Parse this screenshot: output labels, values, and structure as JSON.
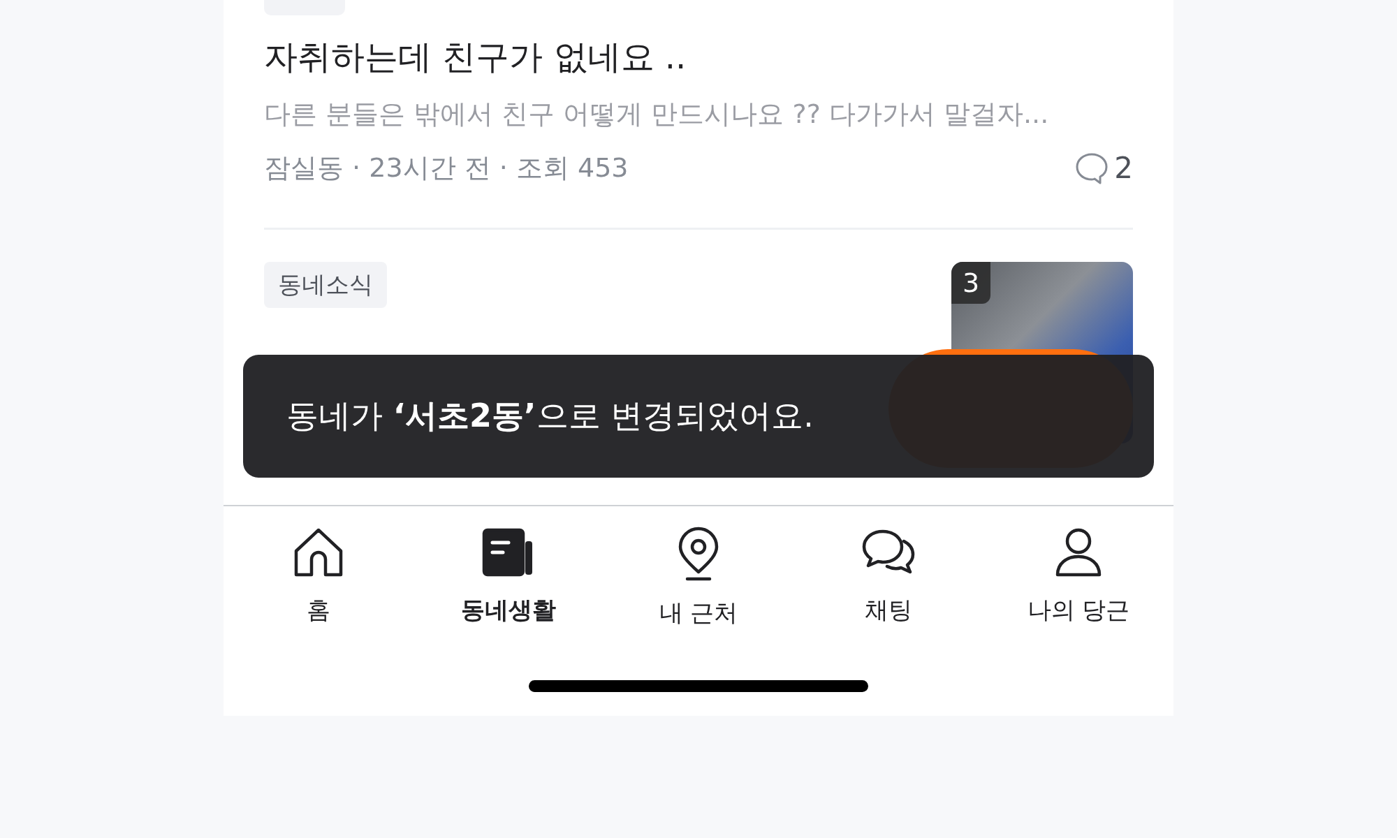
{
  "feed": {
    "posts": [
      {
        "kind": "text",
        "title": "자취하는데 친구가 없네요 ..",
        "preview": "다른 분들은 밖에서 친구 어떻게 만드시나요 ?? 다가가서 말걸자...",
        "meta": "잠실동 · 23시간 전 · 조회 453",
        "comments": "2"
      },
      {
        "kind": "photo",
        "tag": "동네소식",
        "image_count": "3"
      }
    ]
  },
  "toast": {
    "message": "동네가 **‘서초2동’**으로 변경되었어요."
  },
  "tab_bar": {
    "items": [
      {
        "kind": "home",
        "label": "홈",
        "selected": false
      },
      {
        "kind": "life",
        "label": "동네생활",
        "selected": true
      },
      {
        "kind": "near",
        "label": "내 근처",
        "selected": false
      },
      {
        "kind": "chat",
        "label": "채팅",
        "selected": false
      },
      {
        "kind": "profile",
        "label": "나의 당근",
        "selected": false
      }
    ]
  }
}
